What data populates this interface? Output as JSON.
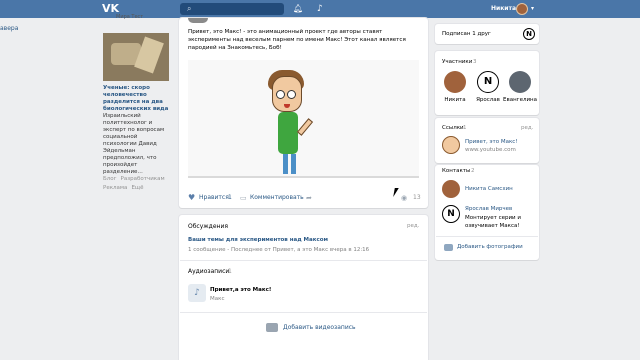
{
  "top_bar": {
    "logo_text": "VK",
    "user_name": "Никита",
    "icons": [
      "search-icon",
      "bell-icon",
      "music-icon",
      "chevron-down-icon"
    ]
  },
  "left_edge": {
    "text": "авера"
  },
  "left_column": {
    "friend_text": "Мира Тест",
    "article": {
      "title": "Ученые: скоро человечество разделится на два биологических вида",
      "text": "Израильский политтехнолог и эксперт по вопросам социальной психологии Давид Эйдельман предположил, что произойдет разделение…"
    },
    "footer_links": [
      "Блог",
      "Разработчикам",
      "Реклама",
      "Ещё"
    ]
  },
  "post": {
    "text": "Привет, это Макс! - это анимационный проект где авторы ставят эксперименты над веселым парнем по имени Макс! Этот канал является пародией на Знакомьтесь, Боб!",
    "like_label": "Нравится",
    "like_count": "1",
    "comment_label": "Комментировать",
    "views_count": "13"
  },
  "discussions": {
    "title": "Обсуждения",
    "edit_label": "ред.",
    "topic": "Ваши темы для экспериментов над Максом",
    "meta": "1 сообщение - Последнее от Привет, а это Макс вчера в 12:16"
  },
  "audio": {
    "title": "Аудиозаписи",
    "count": "1",
    "track_title": "Привет,а это Макс!",
    "track_artist": "Макс"
  },
  "video_add": {
    "label": "Добавить видеозапись"
  },
  "right_column": {
    "subscribe_label": "Подписан 1 друг",
    "members": {
      "title": "Участники",
      "count": "3",
      "names": [
        "Никита",
        "Ярослав",
        "Евангелина"
      ]
    },
    "links": {
      "title": "Ссылки",
      "count": "1",
      "edit_label": "ред.",
      "link_title": "Привет, это Макс!",
      "link_url": "www.youtube.com"
    },
    "contacts": {
      "title": "Контакты",
      "count": "2",
      "items": [
        {
          "name": "Никита Самсхин",
          "desc": ""
        },
        {
          "name": "Ярослав Мирчев",
          "desc": "Монтирует серии и озвучивает Макса!"
        }
      ]
    },
    "add_photo_label": "Добавить фотографии"
  },
  "colors": {
    "top_bar": "#4a76a8",
    "link": "#2a5885",
    "background": "#edeef0"
  }
}
